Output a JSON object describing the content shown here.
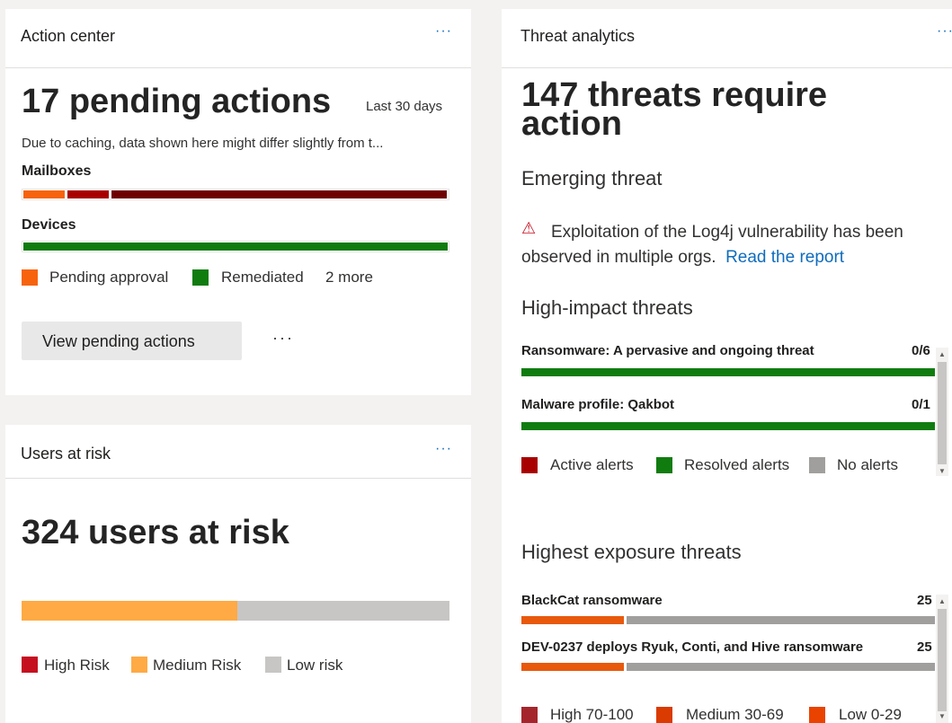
{
  "action_center": {
    "title": "Action center",
    "more": "···",
    "headline": "17 pending actions",
    "period": "Last 30 days",
    "note": "Due to caching, data shown here might differ slightly from t...",
    "mailboxes_label": "Mailboxes",
    "devices_label": "Devices",
    "legend": [
      {
        "label": "Pending approval",
        "color": "#f7630c"
      },
      {
        "label": "Remediated",
        "color": "#107c10"
      }
    ],
    "legend_more": "2 more",
    "view_button": "View pending actions",
    "button_more": "···",
    "colors": {
      "pending": "#f7630c",
      "dark_red": "#a80000",
      "maroon": "#6e0000",
      "remediated": "#107c10"
    }
  },
  "users_at_risk": {
    "title": "Users at risk",
    "more": "···",
    "headline": "324 users at risk",
    "risk_split": {
      "high": 0.0,
      "medium": 0.5,
      "low": 0.5
    },
    "legend": [
      {
        "label": "High Risk",
        "color": "#c50f1f"
      },
      {
        "label": "Medium Risk",
        "color": "#ffaa44"
      },
      {
        "label": "Low risk",
        "color": "#c8c6c4"
      }
    ]
  },
  "threat_analytics": {
    "title": "Threat analytics",
    "more": "···",
    "headline_line1": "147 threats require",
    "headline_line2": "action",
    "emerging_title": "Emerging threat",
    "emerging_text_line1": "Exploitation of the Log4j vulnerability has been",
    "emerging_text_line2": "observed in multiple orgs.",
    "read_report": "Read the report",
    "high_impact_title": "High-impact threats",
    "high_impact": [
      {
        "name": "Ransomware: A pervasive and ongoing threat",
        "count": "0/6"
      },
      {
        "name": "Malware profile: Qakbot",
        "count": "0/1"
      }
    ],
    "high_impact_legend": [
      {
        "label": "Active alerts",
        "color": "#a80000"
      },
      {
        "label": "Resolved alerts",
        "color": "#107c10"
      },
      {
        "label": "No alerts",
        "color": "#a19f9d"
      }
    ],
    "exposure_title": "Highest exposure threats",
    "exposure": [
      {
        "name": "BlackCat ransomware",
        "count": "25"
      },
      {
        "name": "DEV-0237 deploys Ryuk, Conti, and Hive ransomware",
        "count": "25"
      }
    ],
    "exposure_legend": [
      {
        "label": "High 70-100",
        "color": "#a4262c"
      },
      {
        "label": "Medium 30-69",
        "color": "#da3b01"
      },
      {
        "label": "Low 0-29",
        "color": "#ea4300"
      }
    ]
  }
}
